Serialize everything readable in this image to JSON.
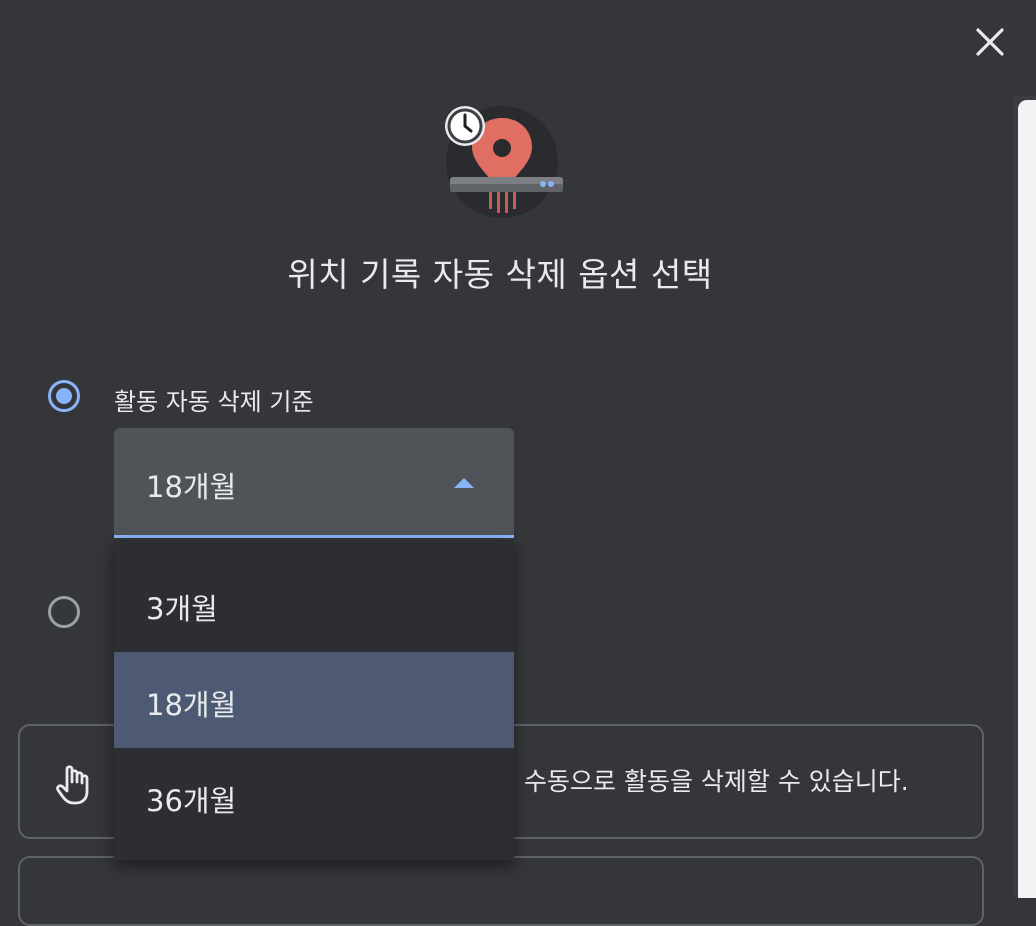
{
  "dialog": {
    "title": "위치 기록 자동 삭제 옵션 선택"
  },
  "options": {
    "auto_delete_label": "활동 자동 삭제 기준",
    "auto_delete_selected": true,
    "second_option_selected": false
  },
  "select": {
    "value": "18개월",
    "expanded": true,
    "options": [
      {
        "label": "3개월",
        "selected": false
      },
      {
        "label": "18개월",
        "selected": true
      },
      {
        "label": "36개월",
        "selected": false
      }
    ]
  },
  "manual_card": {
    "text": "수동으로 활동을 삭제할 수 있습니다.",
    "icon": "hand-pointer-icon"
  },
  "icons": {
    "close": "close-icon",
    "hero": "location-history-icon"
  },
  "colors": {
    "background": "#35363a",
    "accent": "#8ab4f8",
    "menu_selected": "#4e5a74",
    "pin": "#e06e62"
  }
}
